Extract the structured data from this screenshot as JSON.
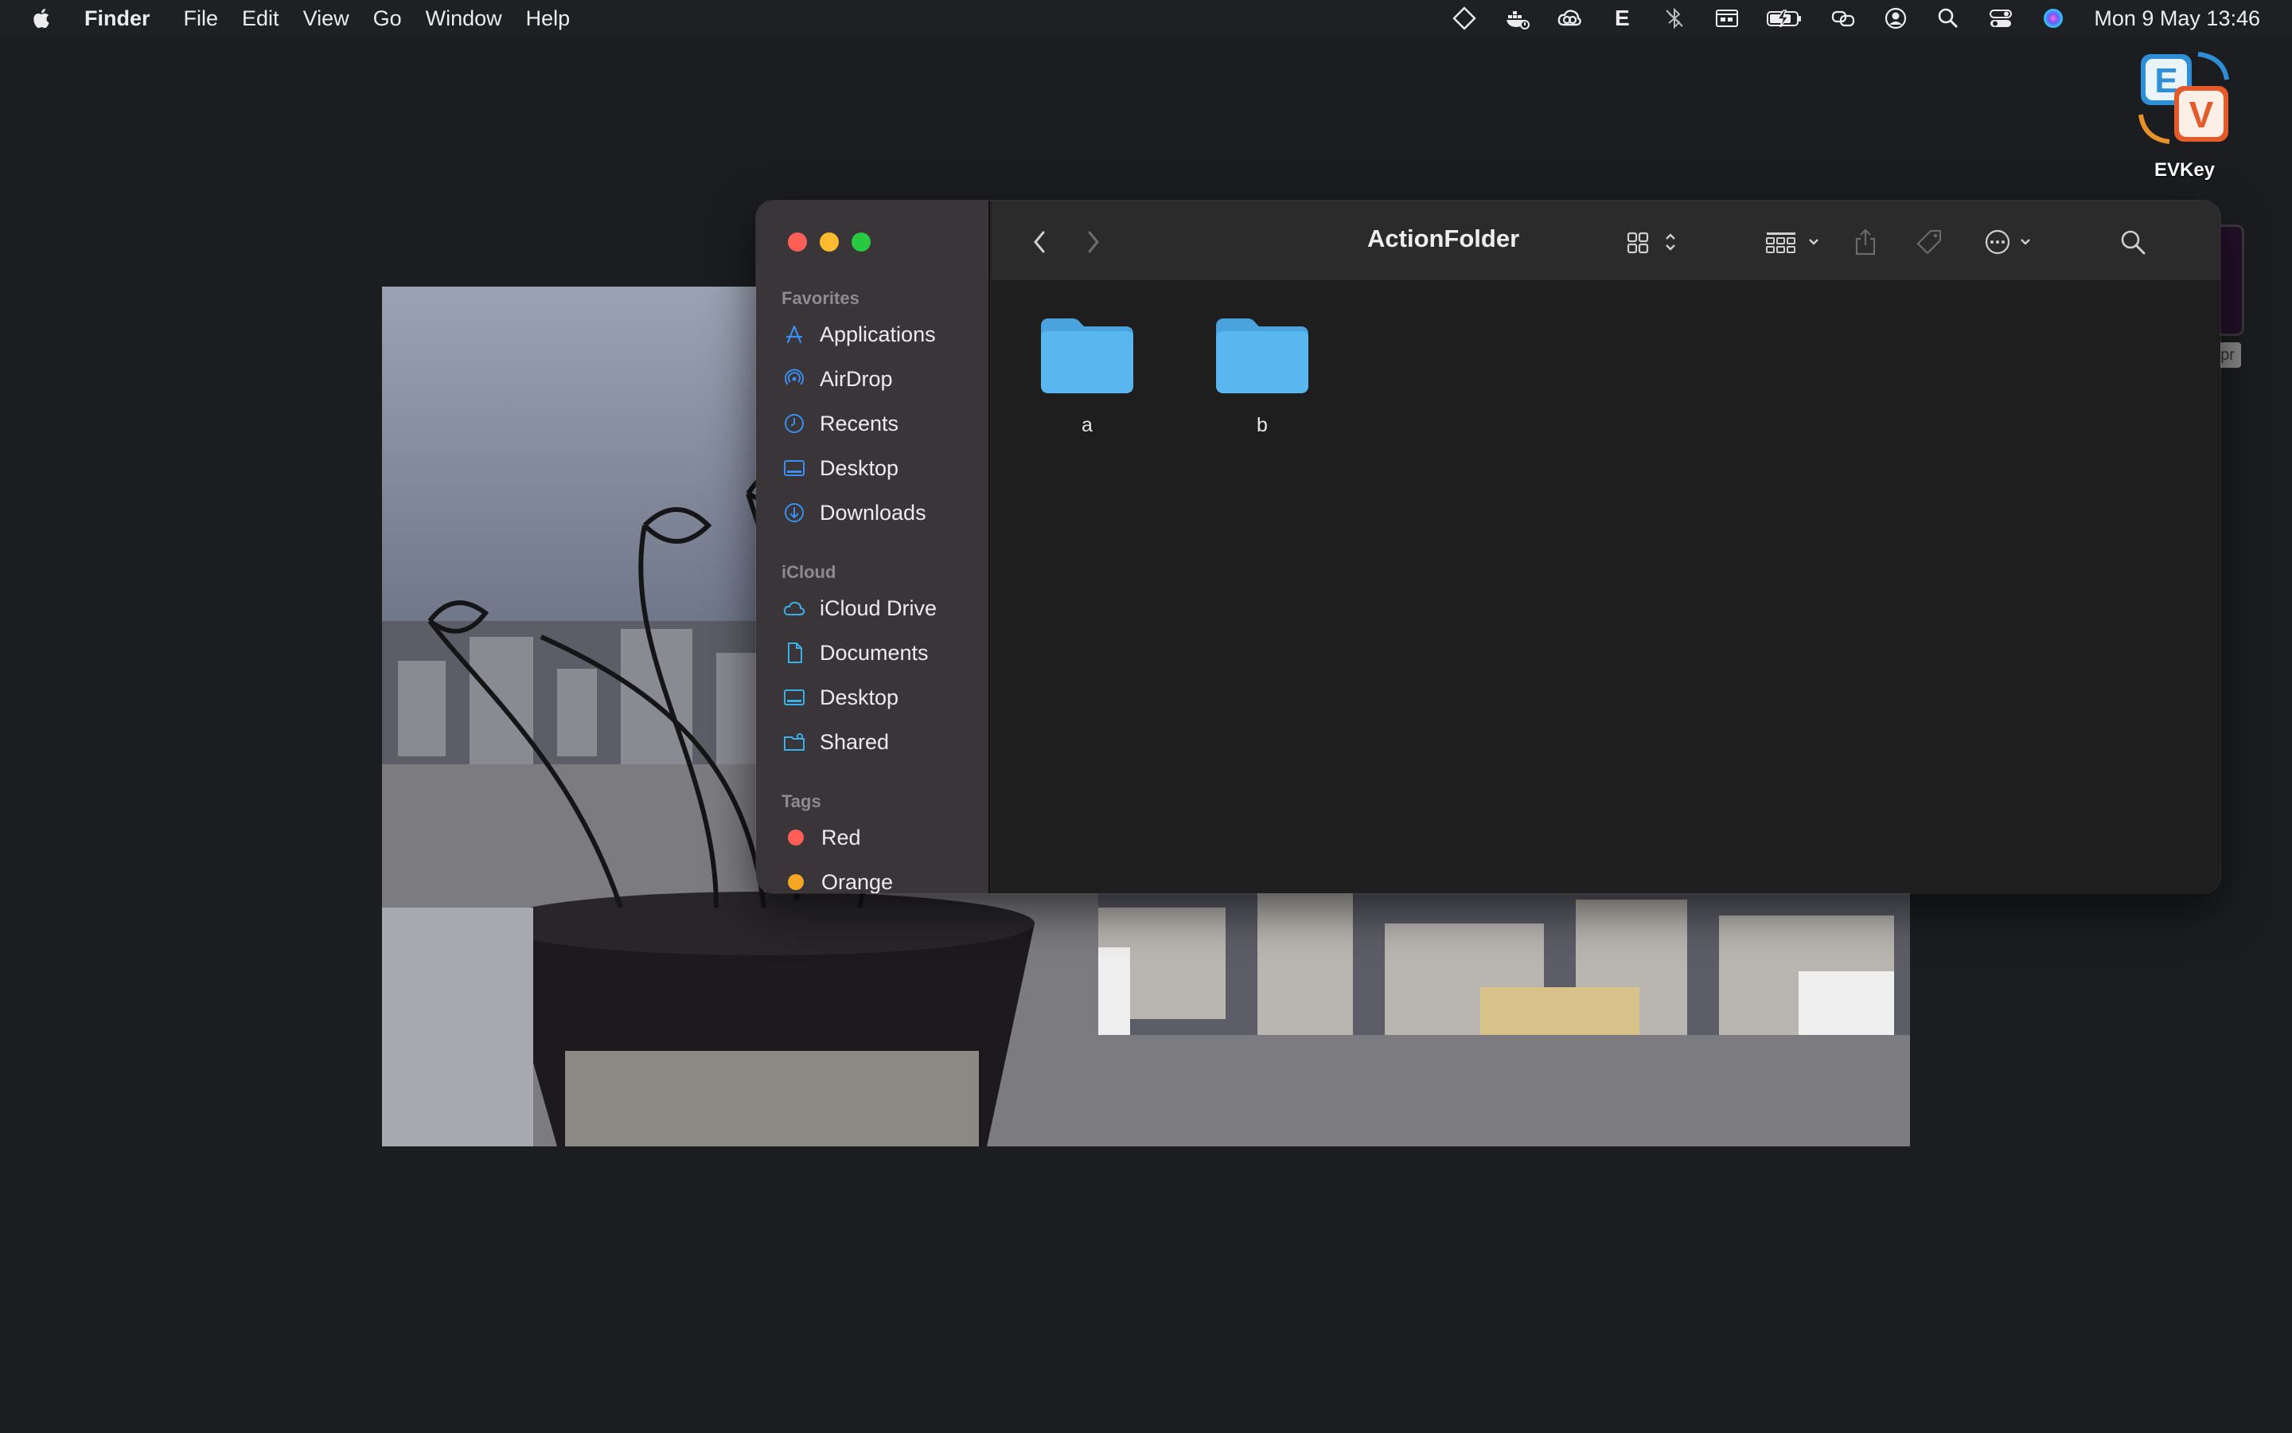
{
  "menubar": {
    "app_name": "Finder",
    "items": [
      "File",
      "Edit",
      "View",
      "Go",
      "Window",
      "Help"
    ],
    "status_icons": [
      "diamond-icon",
      "docker-icon",
      "creative-cloud-icon",
      "e-icon",
      "bluetooth-icon",
      "keyboard-icon",
      "battery-icon",
      "screen-mirroring-icon",
      "user-icon",
      "spotlight-icon",
      "control-center-icon",
      "siri-icon"
    ],
    "status_text": {
      "e": "E"
    },
    "clock": "Mon 9 May  13:46"
  },
  "desktop": {
    "icon_label": "EVKey",
    "peek_tag": "pr"
  },
  "finder": {
    "title": "ActionFolder",
    "sidebar": {
      "favorites_label": "Favorites",
      "favorites": [
        {
          "label": "Applications",
          "icon": "applications-icon"
        },
        {
          "label": "AirDrop",
          "icon": "airdrop-icon"
        },
        {
          "label": "Recents",
          "icon": "clock-icon"
        },
        {
          "label": "Desktop",
          "icon": "desktop-icon"
        },
        {
          "label": "Downloads",
          "icon": "downloads-icon"
        }
      ],
      "icloud_label": "iCloud",
      "icloud": [
        {
          "label": "iCloud Drive",
          "icon": "cloud-icon"
        },
        {
          "label": "Documents",
          "icon": "document-icon"
        },
        {
          "label": "Desktop",
          "icon": "desktop-icon"
        },
        {
          "label": "Shared",
          "icon": "shared-folder-icon"
        }
      ],
      "tags_label": "Tags",
      "tags": [
        {
          "label": "Red",
          "color": "#ff5f57"
        },
        {
          "label": "Orange",
          "color": "#f5a623"
        }
      ]
    },
    "folders": [
      {
        "name": "a"
      },
      {
        "name": "b"
      }
    ]
  },
  "colors": {
    "accent": "#3a8ff0",
    "folder": "#5ab6ee",
    "folder_tab": "#4aa3dc"
  }
}
